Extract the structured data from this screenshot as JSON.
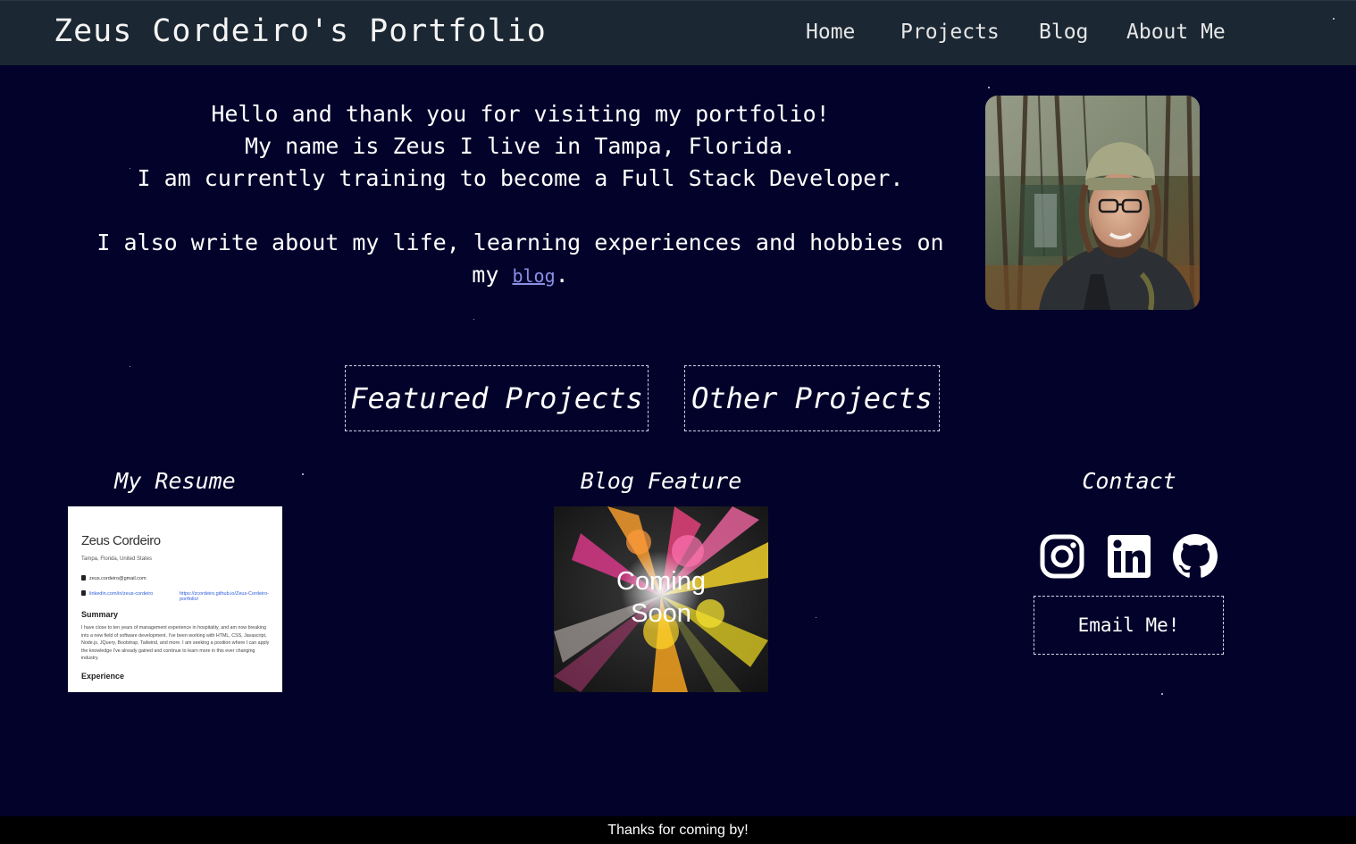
{
  "navbar": {
    "brand": "Zeus Cordeiro's Portfolio",
    "links": [
      "Home",
      "Projects",
      "Blog",
      "About Me"
    ]
  },
  "intro": {
    "line1": "Hello and thank you for visiting my portfolio!",
    "line2": "My name is Zeus I live in Tampa, Florida.",
    "line3": "I am currently training to become a Full Stack Developer.",
    "line4_before": "I also write about my life, learning experiences and hobbies on my ",
    "line4_link": "blog",
    "line4_after": "."
  },
  "projects": {
    "featured_label": "Featured Projects",
    "other_label": "Other Projects"
  },
  "resume": {
    "title": "My Resume",
    "name": "Zeus Cordeiro",
    "location": "Tampa, Florida, United States",
    "email": "zeus.cordeiro@gmail.com",
    "linkedin": "linkedin.com/in/zeus-cordeiro",
    "website": "https://zcordeiro.github.io/Zeus-Cordeiro-portfolio/",
    "summary_heading": "Summary",
    "summary_text": "I have close to ten years of management experience in hospitality, and am now breaking into a new field of software development. I've been working with HTML, CSS, Javascript, Node.js, JQuery, Bootstrap, Tailwind, and more. I am seeking a position where I can apply the knowledge I've already gained and continue to learn more in this ever changing industry.",
    "experience_heading": "Experience"
  },
  "blog_feature": {
    "title": "Blog Feature",
    "overlay_line1": "Coming",
    "overlay_line2": "Soon"
  },
  "contact": {
    "title": "Contact",
    "icons": [
      "instagram-icon",
      "linkedin-icon",
      "github-icon"
    ],
    "email_label": "Email Me!"
  },
  "footer": {
    "text": "Thanks for coming by!"
  },
  "colors": {
    "background": "#03022a",
    "navbar": "#1b2733",
    "link": "#8b8fe6",
    "footer": "#000000"
  }
}
